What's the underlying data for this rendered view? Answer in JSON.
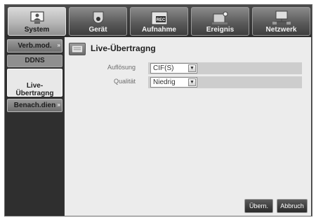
{
  "tabs": [
    {
      "label": "System",
      "icon": "monitor-icon",
      "active": true
    },
    {
      "label": "Gerät",
      "icon": "camera-icon",
      "active": false
    },
    {
      "label": "Aufnahme",
      "icon": "rec-icon",
      "active": false
    },
    {
      "label": "Ereignis",
      "icon": "event-alarm-icon",
      "active": false
    },
    {
      "label": "Netzwerk",
      "icon": "network-icon",
      "active": false
    }
  ],
  "submenu": {
    "group1": "Verb.mod.",
    "item_ddns": "DDNS",
    "item_live": "Live-\nÜbertragng",
    "group2": "Benach.dien"
  },
  "page": {
    "title": "Live-Übertragng"
  },
  "fields": {
    "resolution": {
      "label": "Auflösung",
      "value": "CIF(S)"
    },
    "quality": {
      "label": "Qualität",
      "value": "Niedrig"
    }
  },
  "buttons": {
    "apply": "Übern.",
    "cancel": "Abbruch"
  }
}
